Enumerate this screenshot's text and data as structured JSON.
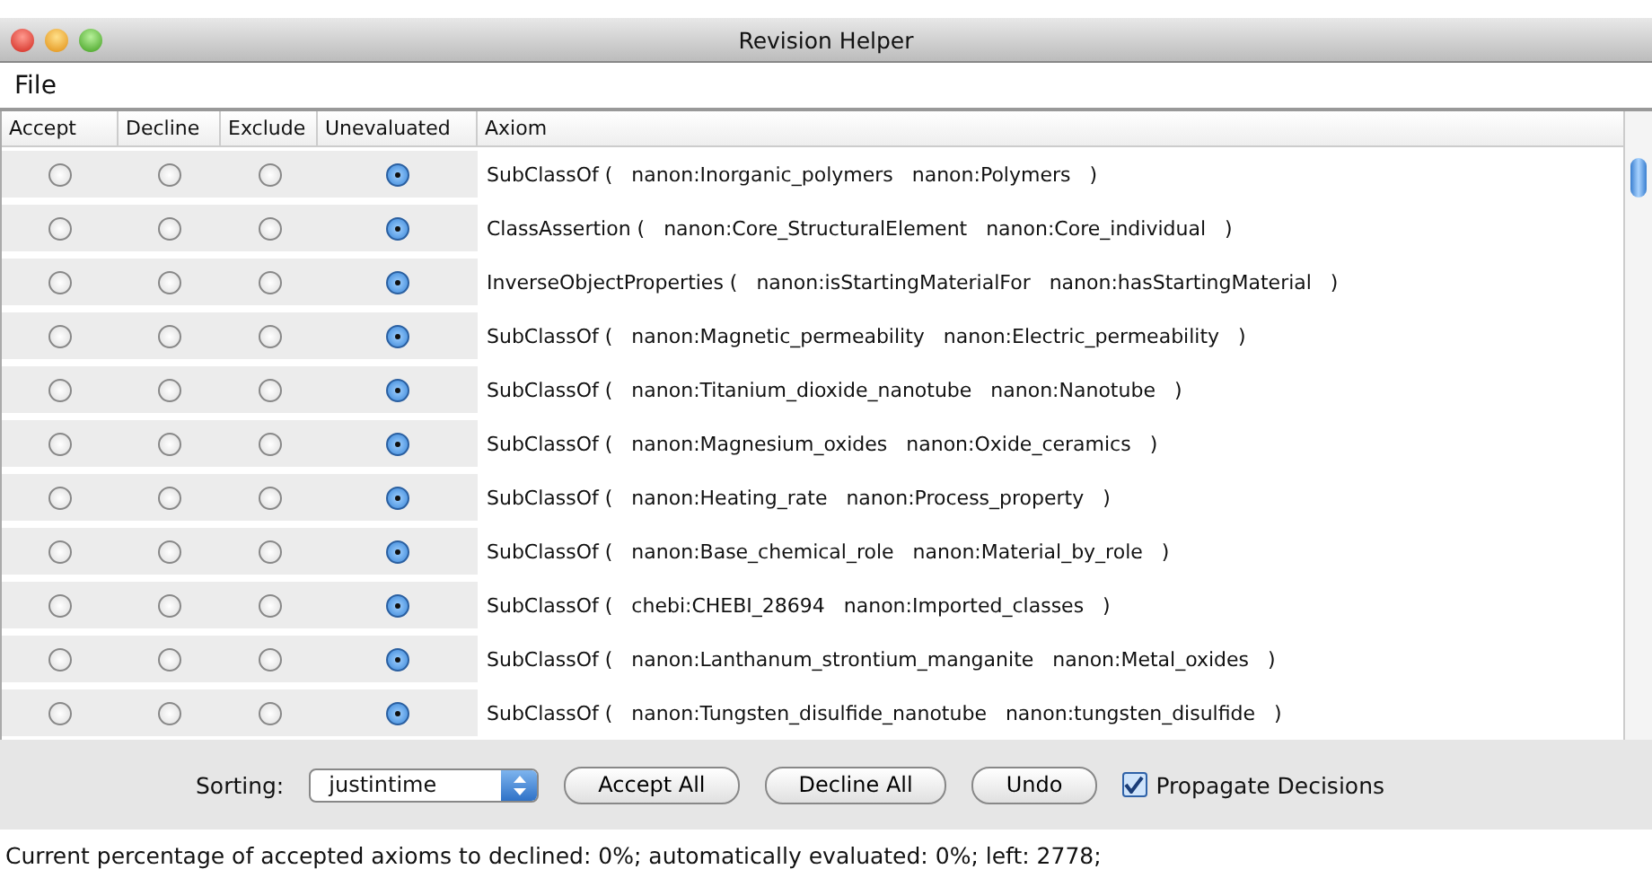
{
  "window": {
    "title": "Revision Helper"
  },
  "menu": [
    "File"
  ],
  "table": {
    "columns": [
      "Accept",
      "Decline",
      "Exclude",
      "Unevaluated",
      "Axiom"
    ],
    "rows": [
      {
        "choices": [
          {
            "selected": false
          },
          {
            "selected": false
          },
          {
            "selected": false
          },
          {
            "selected": true
          }
        ],
        "axiom": "SubClassOf (   nanon:Inorganic_polymers   nanon:Polymers   )"
      },
      {
        "choices": [
          {
            "selected": false
          },
          {
            "selected": false
          },
          {
            "selected": false
          },
          {
            "selected": true
          }
        ],
        "axiom": "ClassAssertion (   nanon:Core_StructuralElement   nanon:Core_individual   )"
      },
      {
        "choices": [
          {
            "selected": false
          },
          {
            "selected": false
          },
          {
            "selected": false
          },
          {
            "selected": true
          }
        ],
        "axiom": "InverseObjectProperties (   nanon:isStartingMaterialFor   nanon:hasStartingMaterial   )"
      },
      {
        "choices": [
          {
            "selected": false
          },
          {
            "selected": false
          },
          {
            "selected": false
          },
          {
            "selected": true
          }
        ],
        "axiom": "SubClassOf (   nanon:Magnetic_permeability   nanon:Electric_permeability   )"
      },
      {
        "choices": [
          {
            "selected": false
          },
          {
            "selected": false
          },
          {
            "selected": false
          },
          {
            "selected": true
          }
        ],
        "axiom": "SubClassOf (   nanon:Titanium_dioxide_nanotube   nanon:Nanotube   )"
      },
      {
        "choices": [
          {
            "selected": false
          },
          {
            "selected": false
          },
          {
            "selected": false
          },
          {
            "selected": true
          }
        ],
        "axiom": "SubClassOf (   nanon:Magnesium_oxides   nanon:Oxide_ceramics   )"
      },
      {
        "choices": [
          {
            "selected": false
          },
          {
            "selected": false
          },
          {
            "selected": false
          },
          {
            "selected": true
          }
        ],
        "axiom": "SubClassOf (   nanon:Heating_rate   nanon:Process_property   )"
      },
      {
        "choices": [
          {
            "selected": false
          },
          {
            "selected": false
          },
          {
            "selected": false
          },
          {
            "selected": true
          }
        ],
        "axiom": "SubClassOf (   nanon:Base_chemical_role   nanon:Material_by_role   )"
      },
      {
        "choices": [
          {
            "selected": false
          },
          {
            "selected": false
          },
          {
            "selected": false
          },
          {
            "selected": true
          }
        ],
        "axiom": "SubClassOf (   chebi:CHEBI_28694   nanon:Imported_classes   )"
      },
      {
        "choices": [
          {
            "selected": false
          },
          {
            "selected": false
          },
          {
            "selected": false
          },
          {
            "selected": true
          }
        ],
        "axiom": "SubClassOf (   nanon:Lanthanum_strontium_manganite   nanon:Metal_oxides   )"
      },
      {
        "choices": [
          {
            "selected": false
          },
          {
            "selected": false
          },
          {
            "selected": false
          },
          {
            "selected": true
          }
        ],
        "axiom": "SubClassOf (   nanon:Tungsten_disulfide_nanotube   nanon:tungsten_disulfide   )"
      }
    ]
  },
  "controls": {
    "sorting_label": "Sorting:",
    "sorting_value": "justintime",
    "buttons": [
      "Accept All",
      "Decline All",
      "Undo"
    ],
    "propagate": {
      "label": "Propagate Decisions",
      "checked": true
    }
  },
  "status_bar": "Current percentage of accepted axioms to declined: 0%; automatically evaluated: 0%; left: 2778;"
}
